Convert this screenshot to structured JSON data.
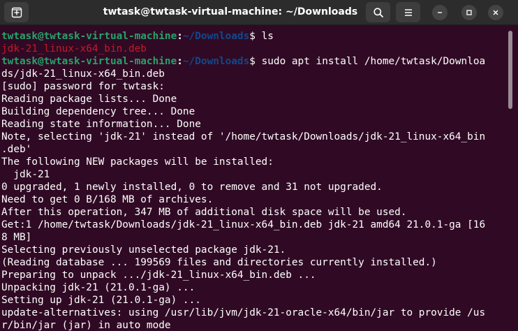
{
  "window": {
    "title": "twtask@twtask-virtual-machine: ~/Downloads"
  },
  "icons": {
    "new_tab": "new-tab-icon",
    "search": "search-icon",
    "menu": "hamburger-menu-icon",
    "minimize": "minimize-icon",
    "maximize": "maximize-icon",
    "close": "close-icon"
  },
  "colors": {
    "background": "#300a24",
    "prompt_user": "#26a269",
    "prompt_path": "#12488b",
    "deb_file": "#c01c28",
    "text": "#ffffff"
  },
  "terminal": {
    "lines": [
      {
        "type": "prompt",
        "user": "twtask@twtask-virtual-machine",
        "sep": ":",
        "path": "~/Downloads",
        "cmd": "$ ls"
      },
      {
        "type": "file",
        "text": "jdk-21_linux-x64_bin.deb"
      },
      {
        "type": "prompt",
        "user": "twtask@twtask-virtual-machine",
        "sep": ":",
        "path": "~/Downloads",
        "cmd": "$ sudo apt install /home/twtask/Downloa"
      },
      {
        "type": "text",
        "text": "ds/jdk-21_linux-x64_bin.deb"
      },
      {
        "type": "text",
        "text": "[sudo] password for twtask:"
      },
      {
        "type": "text",
        "text": "Reading package lists... Done"
      },
      {
        "type": "text",
        "text": "Building dependency tree... Done"
      },
      {
        "type": "text",
        "text": "Reading state information... Done"
      },
      {
        "type": "text",
        "text": "Note, selecting 'jdk-21' instead of '/home/twtask/Downloads/jdk-21_linux-x64_bin"
      },
      {
        "type": "text",
        "text": ".deb'"
      },
      {
        "type": "text",
        "text": "The following NEW packages will be installed:"
      },
      {
        "type": "text",
        "text": "  jdk-21"
      },
      {
        "type": "text",
        "text": "0 upgraded, 1 newly installed, 0 to remove and 31 not upgraded."
      },
      {
        "type": "text",
        "text": "Need to get 0 B/168 MB of archives."
      },
      {
        "type": "text",
        "text": "After this operation, 347 MB of additional disk space will be used."
      },
      {
        "type": "text",
        "text": "Get:1 /home/twtask/Downloads/jdk-21_linux-x64_bin.deb jdk-21 amd64 21.0.1-ga [16"
      },
      {
        "type": "text",
        "text": "8 MB]"
      },
      {
        "type": "text",
        "text": "Selecting previously unselected package jdk-21."
      },
      {
        "type": "text",
        "text": "(Reading database ... 199569 files and directories currently installed.)"
      },
      {
        "type": "text",
        "text": "Preparing to unpack .../jdk-21_linux-x64_bin.deb ..."
      },
      {
        "type": "text",
        "text": "Unpacking jdk-21 (21.0.1-ga) ..."
      },
      {
        "type": "text",
        "text": "Setting up jdk-21 (21.0.1-ga) ..."
      },
      {
        "type": "text",
        "text": "update-alternatives: using /usr/lib/jvm/jdk-21-oracle-x64/bin/jar to provide /us"
      },
      {
        "type": "text",
        "text": "r/bin/jar (jar) in auto mode"
      }
    ]
  }
}
